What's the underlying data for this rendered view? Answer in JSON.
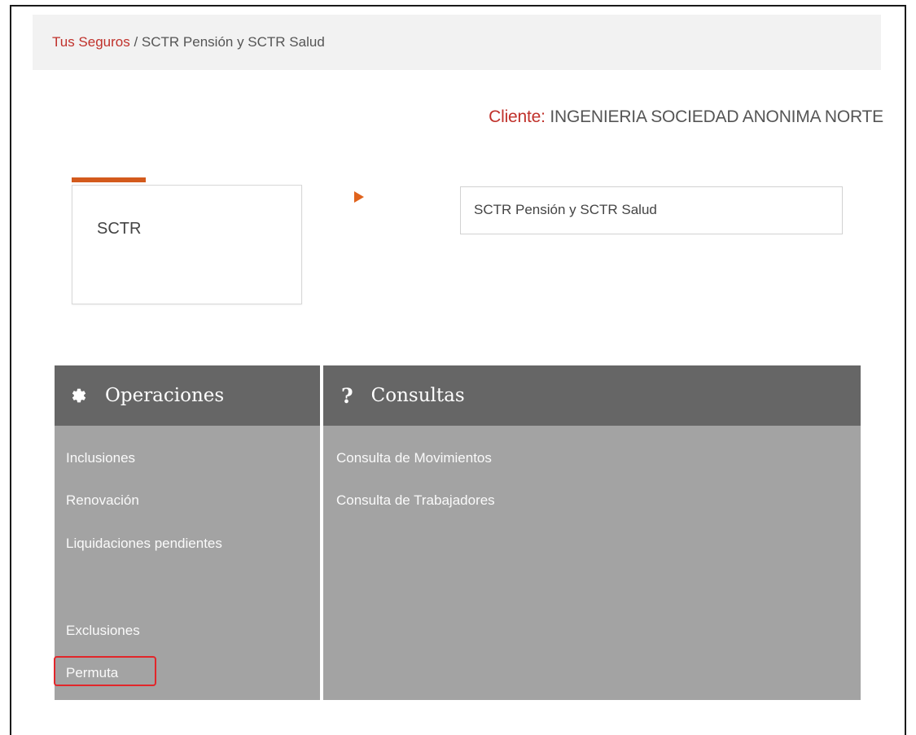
{
  "breadcrumb": {
    "link": "Tus Seguros",
    "separator": " / ",
    "current": "SCTR Pensión y SCTR Salud"
  },
  "client": {
    "label": "Cliente:",
    "name": "INGENIERIA SOCIEDAD ANONIMA NORTE"
  },
  "product_card": {
    "label": "SCTR"
  },
  "product_select": {
    "value": "SCTR Pensión y SCTR Salud"
  },
  "operaciones": {
    "title": "Operaciones",
    "icon": "gear-icon",
    "items": [
      "Inclusiones",
      "Renovación",
      "Liquidaciones pendientes",
      "Exclusiones",
      "Permuta"
    ]
  },
  "consultas": {
    "title": "Consultas",
    "icon": "question-icon",
    "items": [
      "Consulta de Movimientos",
      "Consulta de Trabajadores"
    ]
  },
  "colors": {
    "accent": "#c0312b",
    "orange": "#e0631d",
    "panel_header": "#666666",
    "panel_body": "#a3a3a3",
    "highlight": "#e2262a"
  }
}
